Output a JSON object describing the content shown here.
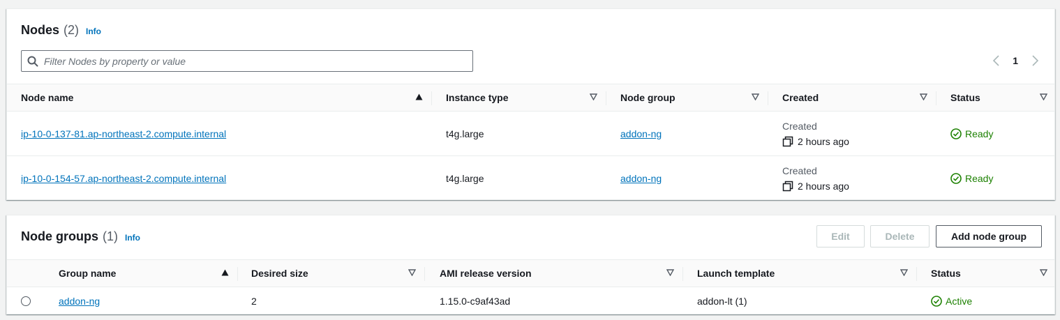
{
  "nodes": {
    "title": "Nodes",
    "count": "(2)",
    "info": "Info",
    "filter_placeholder": "Filter Nodes by property or value",
    "page": "1",
    "columns": [
      "Node name",
      "Instance type",
      "Node group",
      "Created",
      "Status"
    ],
    "rows": [
      {
        "name": "ip-10-0-137-81.ap-northeast-2.compute.internal",
        "instance_type": "t4g.large",
        "node_group": "addon-ng",
        "created_label": "Created",
        "created_time": "2 hours ago",
        "status": "Ready"
      },
      {
        "name": "ip-10-0-154-57.ap-northeast-2.compute.internal",
        "instance_type": "t4g.large",
        "node_group": "addon-ng",
        "created_label": "Created",
        "created_time": "2 hours ago",
        "status": "Ready"
      }
    ]
  },
  "node_groups": {
    "title": "Node groups",
    "count": "(1)",
    "info": "Info",
    "buttons": {
      "edit": "Edit",
      "delete": "Delete",
      "add": "Add node group"
    },
    "columns": [
      "Group name",
      "Desired size",
      "AMI release version",
      "Launch template",
      "Status"
    ],
    "rows": [
      {
        "name": "addon-ng",
        "desired_size": "2",
        "ami_release": "1.15.0-c9af43ad",
        "launch_template": "addon-lt (1)",
        "status": "Active"
      }
    ]
  },
  "colors": {
    "link": "#0073bb",
    "success": "#1d8102",
    "header_bg": "#fafafa"
  },
  "icons": {
    "search": "search-icon",
    "copy": "copy-icon",
    "status_ok": "status-check-icon",
    "sort_asc": "sort-ascending-icon",
    "sort_desc": "sort-descending-icon",
    "prev": "chevron-left-icon",
    "next": "chevron-right-icon"
  }
}
